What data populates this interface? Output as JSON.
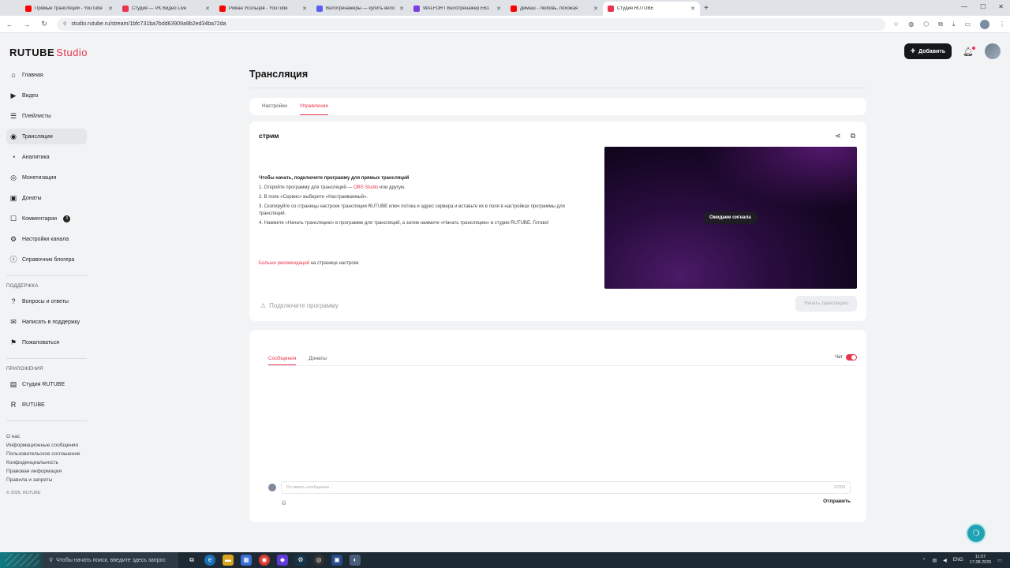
{
  "browser": {
    "tabs": [
      {
        "title": "Прямые трансляции - YouTube",
        "color": "#ff0000",
        "active": false
      },
      {
        "title": "Студия — VK Видео Live",
        "color": "#e8344e",
        "active": false
      },
      {
        "title": "Роман Усольцев - YouTube",
        "color": "#ff0000",
        "active": false
      },
      {
        "title": "Велотренажеры — купить вело",
        "color": "#5b5ef0",
        "active": false
      },
      {
        "title": "WALFORT Велотренажер EB1",
        "color": "#7a3fe0",
        "active": false
      },
      {
        "title": "Димаш - Любовь, похожая",
        "color": "#ff0000",
        "active": false
      },
      {
        "title": "Студия RUTUBE",
        "color": "#e8344e",
        "active": true
      }
    ],
    "new_tab": "+",
    "url": "studio.rutube.ru/stream/1bfc731ba7bdd63909a9b2ed34ba72da"
  },
  "header": {
    "logo_main": "RUTUBE",
    "logo_studio": "Studio",
    "add_button": "Добавить"
  },
  "sidebar": {
    "items": [
      {
        "label": "Главная",
        "icon": "⌂"
      },
      {
        "label": "Видео",
        "icon": "▶"
      },
      {
        "label": "Плейлисты",
        "icon": "☰"
      },
      {
        "label": "Трансляции",
        "icon": "◉"
      },
      {
        "label": "Аналитика",
        "icon": "◔"
      },
      {
        "label": "Монетизация",
        "icon": "◎"
      },
      {
        "label": "Донаты",
        "icon": "▣"
      },
      {
        "label": "Комментарии",
        "icon": "☐",
        "badge": "3"
      },
      {
        "label": "Настройки канала",
        "icon": "⚙"
      },
      {
        "label": "Справочник блогера",
        "icon": "ⓘ"
      }
    ],
    "support_heading": "ПОДДЕРЖКА",
    "support_items": [
      {
        "label": "Вопросы и ответы",
        "icon": "?"
      },
      {
        "label": "Написать в поддержку",
        "icon": "✉"
      },
      {
        "label": "Пожаловаться",
        "icon": "⚑"
      }
    ],
    "apps_heading": "ПРИЛОЖЕНИЯ",
    "apps_items": [
      {
        "label": "Студия RUTUBE",
        "icon": "▤"
      },
      {
        "label": "RUTUBE",
        "icon": "R"
      }
    ],
    "footer_links": [
      "О нас",
      "Информационные сообщения",
      "Пользовательское соглашение",
      "Конфиденциальность",
      "Правовая информация",
      "Правила и запреты"
    ],
    "copyright": "© 2025, RUTUBE"
  },
  "main": {
    "page_title": "Трансляция",
    "tabs": [
      "Настройки",
      "Управление"
    ],
    "stream_name": "стрим",
    "instructions": {
      "title": "Чтобы начать, подключите программу для прямых трансляций",
      "step1_pre": "1. Откройте программу для трансляций — ",
      "step1_link": "OBS Studio",
      "step1_post": " или другую.",
      "step2": "2. В поле «Сервис» выберите «Настраиваемый».",
      "step3": "3. Скопируйте со страницы настроек трансляции RUTUBE ключ потока и адрес сервера и вставьте их в поля в настройках программы для трансляций.",
      "step4": "4. Нажмите «Начать трансляцию» в программе для трансляций, а затем нажмите «Начать трансляцию» в студии RUTUBE. Готово!"
    },
    "more_link": "Больше рекомендаций",
    "more_post": " на странице настроек",
    "connect_program": "Подключите программу",
    "preview_status": "Ожидаем сигнала",
    "start_button": "Начать трансляцию",
    "chat": {
      "tabs": [
        "Сообщения",
        "Донаты"
      ],
      "toggle_label": "Чат",
      "placeholder": "Оставить сообщение...",
      "counter": "0/200",
      "send": "Отправить"
    }
  },
  "taskbar": {
    "search_placeholder": "Чтобы начать поиск, введите здесь запрос",
    "lang": "ENG",
    "time": "11:57",
    "date": "17.08.2025"
  },
  "colors": {
    "accent": "#e8344e",
    "dark_button": "#16171a",
    "help_fab": "#22a3b3"
  }
}
